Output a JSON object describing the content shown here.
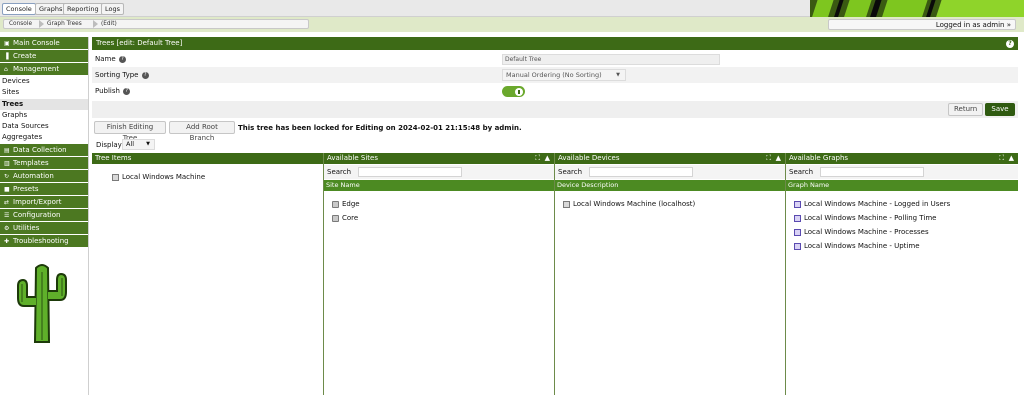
{
  "top_tabs": [
    {
      "label": "Console",
      "active": true
    },
    {
      "label": "Graphs",
      "active": false
    },
    {
      "label": "Reporting",
      "active": false
    },
    {
      "label": "Logs",
      "active": false
    }
  ],
  "breadcrumbs": [
    "Console",
    "Graph Trees",
    "(Edit)"
  ],
  "logged_in": "Logged in as admin »",
  "sidebar": {
    "items": [
      {
        "type": "head",
        "label": "Main Console",
        "icon": "home-icon",
        "glyph": "▣"
      },
      {
        "type": "head",
        "label": "Create",
        "icon": "chart-icon",
        "glyph": "▐"
      },
      {
        "type": "head",
        "label": "Management",
        "icon": "house-icon",
        "glyph": "⌂"
      },
      {
        "type": "sub",
        "label": "Devices"
      },
      {
        "type": "sub",
        "label": "Sites"
      },
      {
        "type": "sub",
        "label": "Trees",
        "active": true
      },
      {
        "type": "sub",
        "label": "Graphs"
      },
      {
        "type": "sub",
        "label": "Data Sources"
      },
      {
        "type": "sub",
        "label": "Aggregates"
      },
      {
        "type": "head",
        "label": "Data Collection",
        "icon": "database-icon",
        "glyph": "▤"
      },
      {
        "type": "head",
        "label": "Templates",
        "icon": "template-icon",
        "glyph": "▥"
      },
      {
        "type": "head",
        "label": "Automation",
        "icon": "refresh-icon",
        "glyph": "↻"
      },
      {
        "type": "head",
        "label": "Presets",
        "icon": "preset-icon",
        "glyph": "■"
      },
      {
        "type": "head",
        "label": "Import/Export",
        "icon": "transfer-icon",
        "glyph": "⇄"
      },
      {
        "type": "head",
        "label": "Configuration",
        "icon": "sliders-icon",
        "glyph": "☰"
      },
      {
        "type": "head",
        "label": "Utilities",
        "icon": "gears-icon",
        "glyph": "⚙"
      },
      {
        "type": "head",
        "label": "Troubleshooting",
        "icon": "medkit-icon",
        "glyph": "✚"
      }
    ]
  },
  "tree_form": {
    "header": "Trees [edit: Default Tree]",
    "help_glyph": "?",
    "name_label": "Name",
    "name_value": "Default Tree",
    "sorting_label": "Sorting Type",
    "sorting_value": "Manual Ordering (No Sorting)",
    "publish_label": "Publish",
    "publish_on": true
  },
  "buttons": {
    "return": "Return",
    "save": "Save",
    "finish_editing": "Finish Editing Tree",
    "add_root_branch": "Add Root Branch"
  },
  "lock_message": "This tree has been locked for Editing on 2024-02-01 21:15:48 by admin.",
  "display": {
    "label": "Display",
    "value": "All"
  },
  "panels": {
    "tree_items": {
      "title": "Tree Items",
      "items": [
        "Local Windows Machine"
      ]
    },
    "sites": {
      "title": "Available Sites",
      "search_label": "Search",
      "column": "Site Name",
      "items": [
        "Edge",
        "Core"
      ]
    },
    "devices": {
      "title": "Available Devices",
      "search_label": "Search",
      "column": "Device Description",
      "items": [
        "Local Windows Machine (localhost)"
      ]
    },
    "graphs": {
      "title": "Available Graphs",
      "search_label": "Search",
      "column": "Graph Name",
      "items": [
        "Local Windows Machine - Logged in Users",
        "Local Windows Machine - Polling Time",
        "Local Windows Machine - Processes",
        "Local Windows Machine - Uptime"
      ]
    }
  },
  "colors": {
    "brand_green": "#3d6a16",
    "menu_green": "#4c7821",
    "column_green": "#4c8a22"
  }
}
